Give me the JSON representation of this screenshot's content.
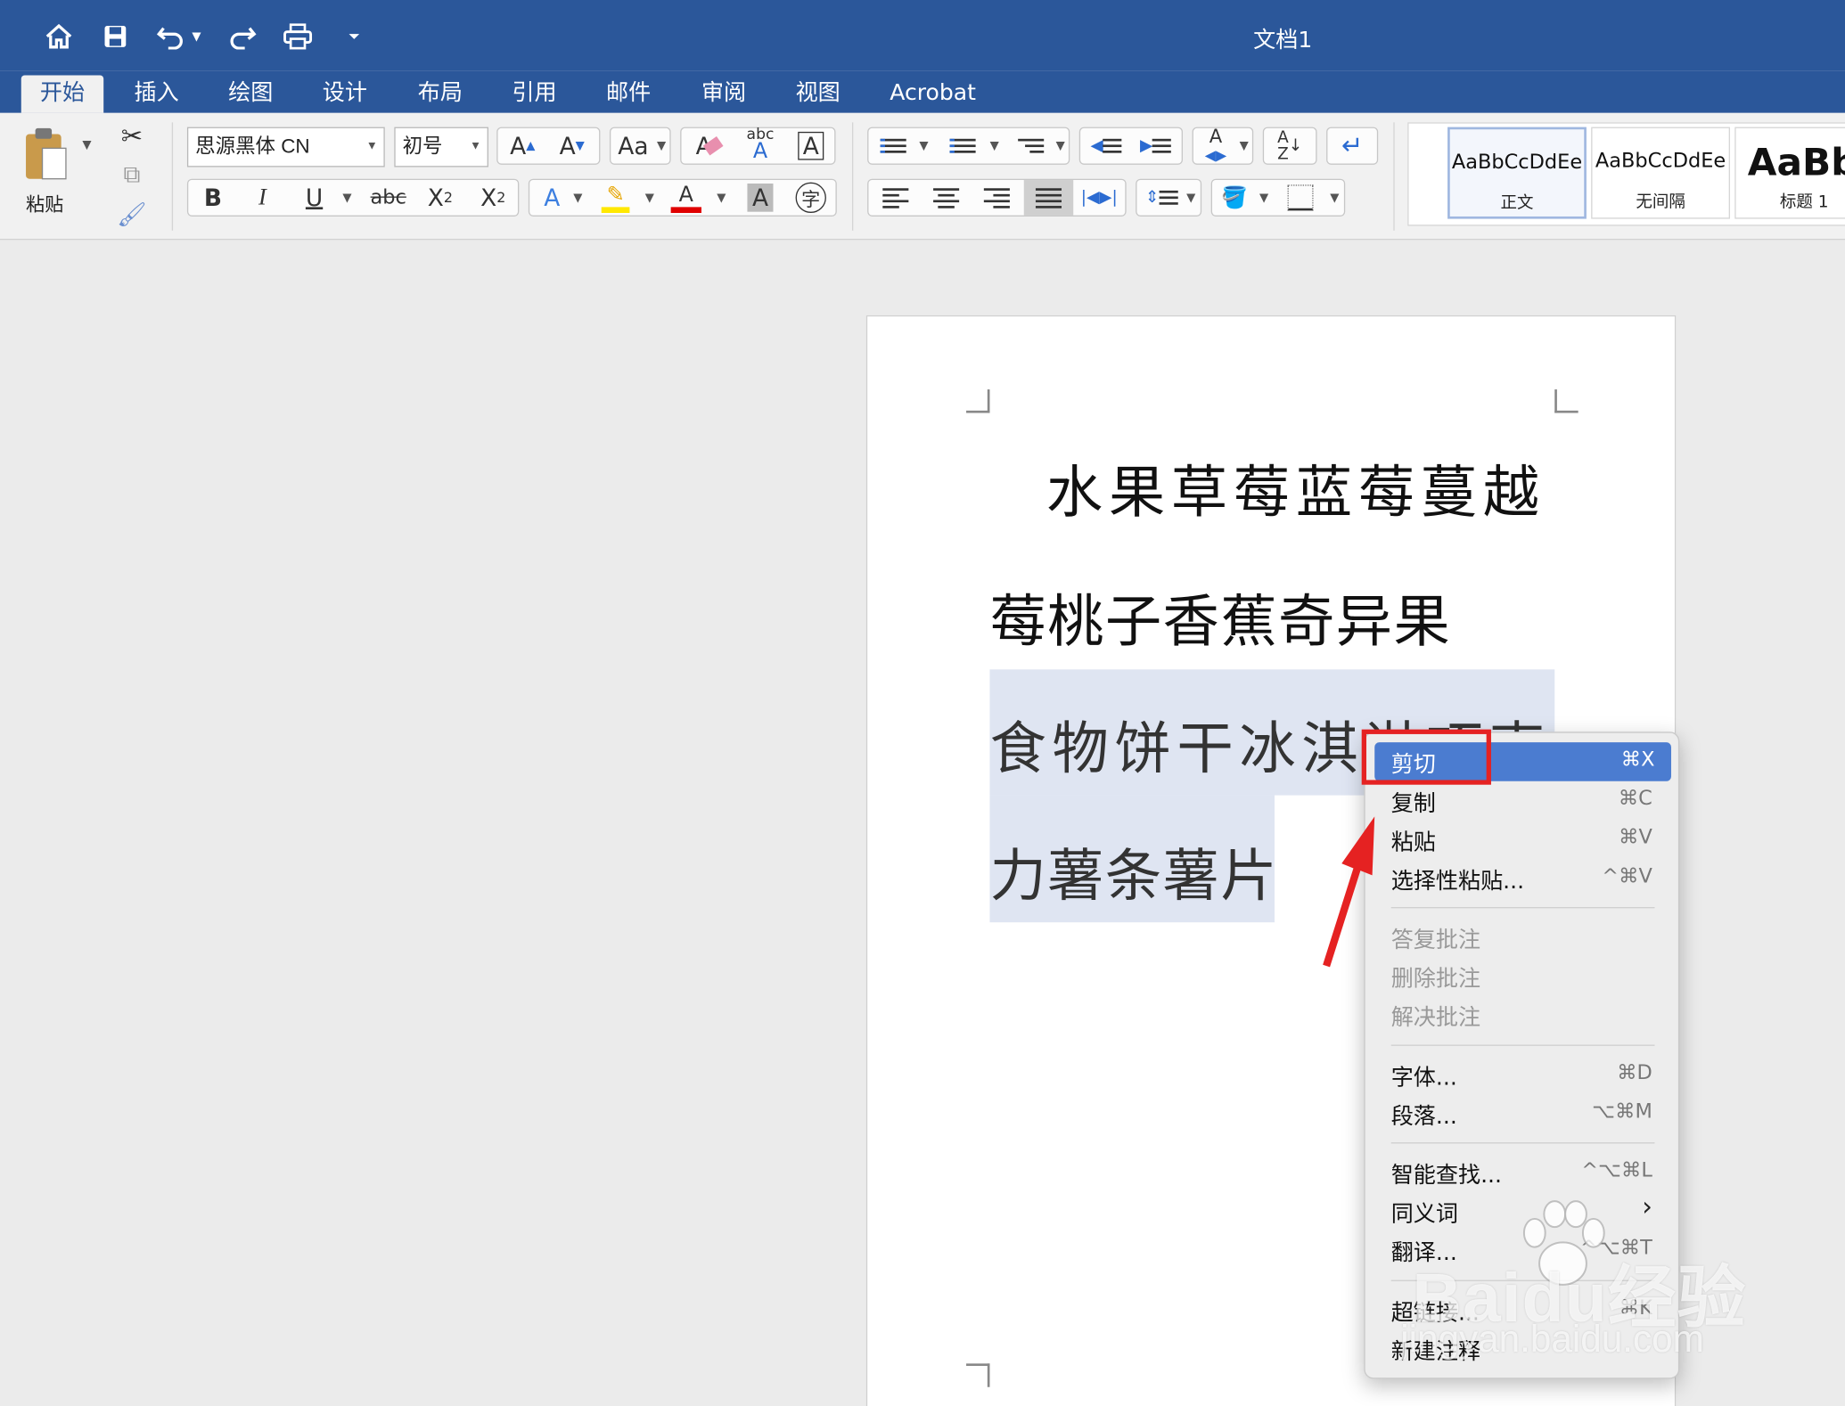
{
  "window": {
    "title": "文档1"
  },
  "ribbon_tabs": [
    "开始",
    "插入",
    "绘图",
    "设计",
    "布局",
    "引用",
    "邮件",
    "审阅",
    "视图",
    "Acrobat"
  ],
  "clipboard": {
    "paste_label": "粘贴"
  },
  "font": {
    "name": "思源黑体 CN",
    "size": "初号"
  },
  "font_buttons": {
    "bold": "B",
    "italic": "I",
    "underline": "U",
    "strike": "abc",
    "subscript": "X",
    "sub_mark": "2",
    "superscript": "X",
    "sup_mark": "2",
    "spell_mark": "abc",
    "phonetic": "字"
  },
  "colors": {
    "accent": "#2b579a",
    "selection": "#dfe5f2",
    "menu_highlight": "#4b7cd0",
    "annotation": "#e52222",
    "font_color": "#e00000",
    "highlight_color": "#ffe800"
  },
  "styles": [
    {
      "sample": "AaBbCcDdEe",
      "name": "正文"
    },
    {
      "sample": "AaBbCcDdEe",
      "name": "无间隔"
    },
    {
      "sample": "AaBb",
      "name": "标题 1"
    }
  ],
  "document": {
    "line1": "水果草莓蓝莓蔓越",
    "line2": "莓桃子香蕉奇异果",
    "line3": "食物饼干冰淇淋巧克",
    "line4": "力薯条薯片"
  },
  "context_menu": {
    "cut": {
      "label": "剪切",
      "shortcut": "⌘X"
    },
    "copy": {
      "label": "复制",
      "shortcut": "⌘C"
    },
    "paste": {
      "label": "粘贴",
      "shortcut": "⌘V"
    },
    "paste_special": {
      "label": "选择性粘贴...",
      "shortcut": "^⌘V"
    },
    "reply_comment": {
      "label": "答复批注"
    },
    "delete_comment": {
      "label": "删除批注"
    },
    "resolve_comment": {
      "label": "解决批注"
    },
    "font": {
      "label": "字体...",
      "shortcut": "⌘D"
    },
    "paragraph": {
      "label": "段落...",
      "shortcut": "⌥⌘M"
    },
    "smart_lookup": {
      "label": "智能查找...",
      "shortcut": "^⌥⌘L"
    },
    "synonyms": {
      "label": "同义词",
      "shortcut": "›"
    },
    "translate": {
      "label": "翻译...",
      "shortcut": "^⌥⌘T"
    },
    "hyperlink": {
      "label": "超链接...",
      "shortcut": "⌘K"
    },
    "new_comment": {
      "label": "新建注释"
    }
  },
  "watermark": {
    "logo": "Baidu经验",
    "url": "jingyan.baidu.com"
  }
}
